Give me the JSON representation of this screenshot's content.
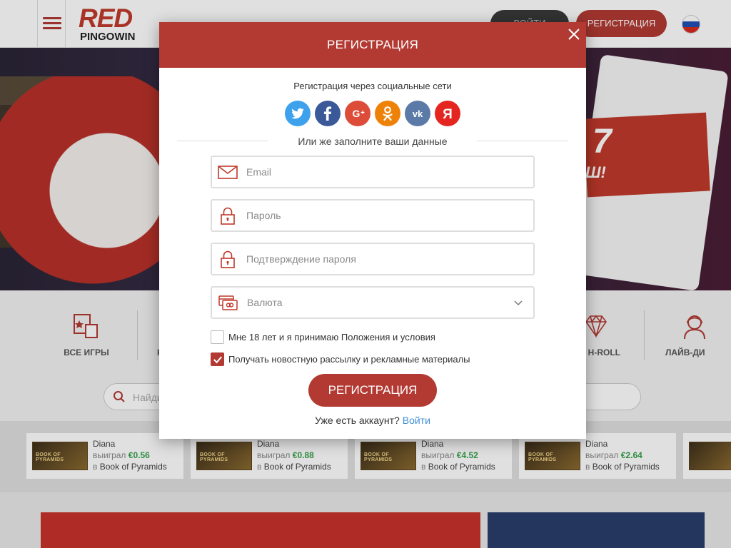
{
  "header": {
    "logo_main": "RED",
    "logo_sub": "PINGOWIN",
    "login_label": "ВОЙТИ",
    "register_label": "РЕГИСТРАЦИЯ"
  },
  "banner": {
    "promo_big": "7",
    "promo_small": "Ш!"
  },
  "categories": [
    {
      "label": "ВСЕ ИГРЫ",
      "icon": "all-games-icon"
    },
    {
      "label": "Н",
      "icon": "new-icon"
    },
    {
      "label": "H-ROLL",
      "icon": "diamond-icon"
    },
    {
      "label": "ЛАЙВ-ДИ",
      "icon": "live-dealer-icon"
    }
  ],
  "search": {
    "placeholder": "Найди"
  },
  "winners": [
    {
      "thumb": "BOOK OF PYRAMIDS",
      "name": "Diana",
      "won_label": "выиграл",
      "amount": "€0.56",
      "in_label": "в",
      "game": "Book of Pyramids"
    },
    {
      "thumb": "BOOK OF PYRAMIDS",
      "name": "Diana",
      "won_label": "выиграл",
      "amount": "€0.88",
      "in_label": "в",
      "game": "Book of Pyramids"
    },
    {
      "thumb": "BOOK OF PYRAMIDS",
      "name": "Diana",
      "won_label": "выиграл",
      "amount": "€4.52",
      "in_label": "в",
      "game": "Book of Pyramids"
    },
    {
      "thumb": "BOOK OF PYRAMIDS",
      "name": "Diana",
      "won_label": "выиграл",
      "amount": "€2.64",
      "in_label": "в",
      "game": "Book of Pyramids"
    }
  ],
  "modal": {
    "title": "РЕГИСТРАЦИЯ",
    "social_caption": "Регистрация через социальные сети",
    "socials": [
      {
        "name": "twitter",
        "color": "#3ea1ec"
      },
      {
        "name": "facebook",
        "color": "#3b5998"
      },
      {
        "name": "google-plus",
        "color": "#dd4b39"
      },
      {
        "name": "odnoklassniki",
        "color": "#ee8208"
      },
      {
        "name": "vkontakte",
        "color": "#5b7aa8"
      },
      {
        "name": "yandex",
        "color": "#e52620"
      }
    ],
    "divider_text": "Или же заполните ваши данные",
    "email_placeholder": "Email",
    "password_placeholder": "Пароль",
    "password_confirm_placeholder": "Подтверждение пароля",
    "currency_placeholder": "Валюта",
    "terms_label": "Мне 18 лет и я принимаю Положения и условия",
    "terms_checked": false,
    "newsletter_label": "Получать новостную рассылку и рекламные материалы",
    "newsletter_checked": true,
    "submit_label": "РЕГИСТРАЦИЯ",
    "have_account_text": "Уже есть аккаунт?",
    "login_link": "Войти"
  },
  "colors": {
    "brand_red": "#b23a33",
    "link_blue": "#3e8fd6",
    "win_green": "#35a24a"
  }
}
